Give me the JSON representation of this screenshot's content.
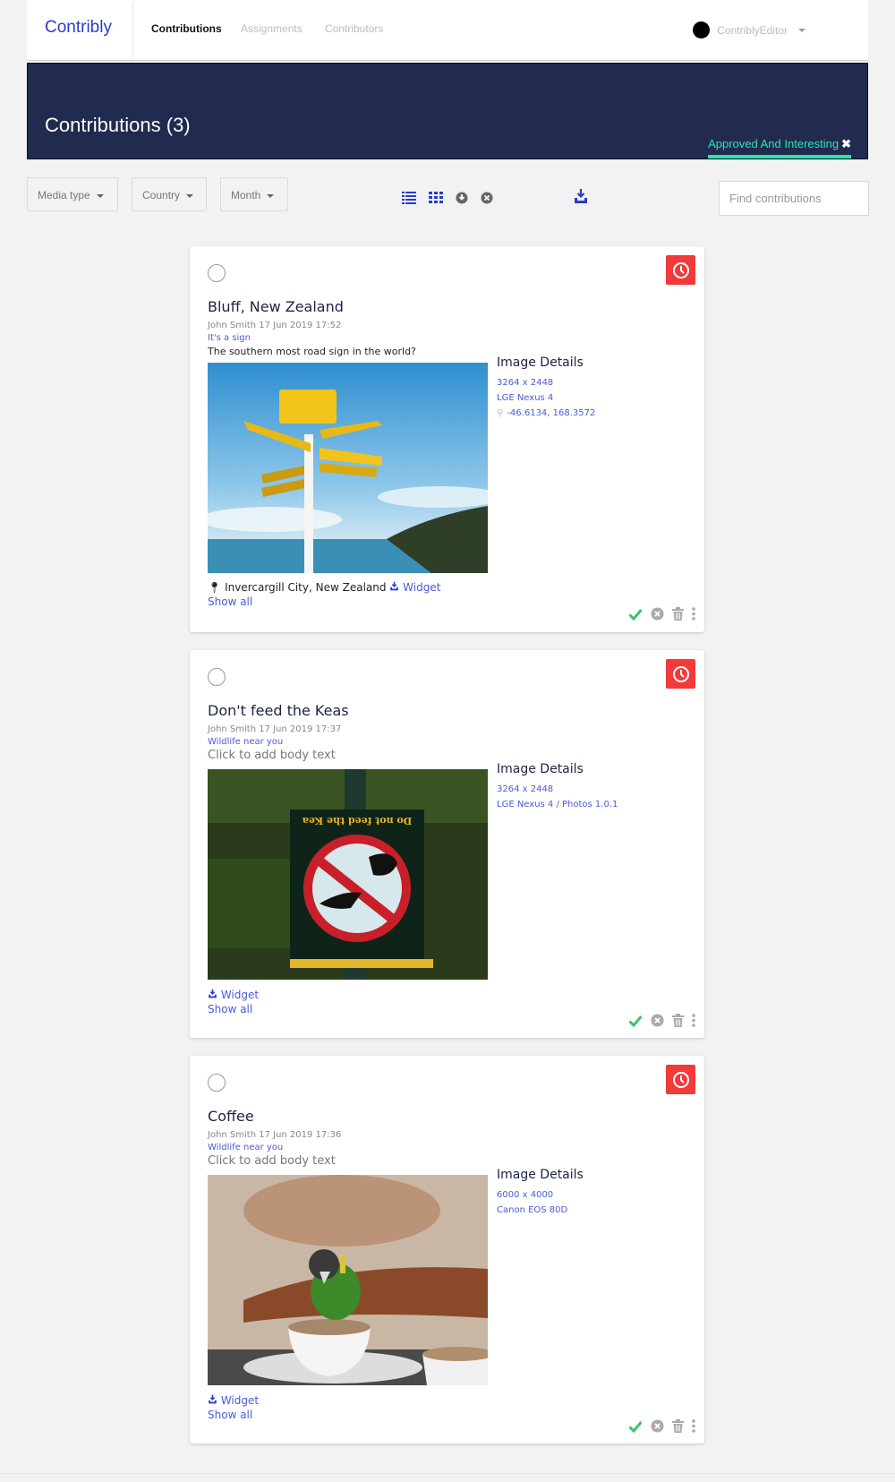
{
  "nav": {
    "brand": "Contribly",
    "items": [
      {
        "label": "Contributions",
        "active": true
      },
      {
        "label": "Assignments",
        "active": false
      },
      {
        "label": "Contributors",
        "active": false
      }
    ],
    "user": "ContriblyEditor"
  },
  "banner": {
    "title": "Contributions (3)",
    "filter_tag": "Approved And Interesting",
    "filter_close_icon": "close-icon"
  },
  "toolbar": {
    "dropdowns": [
      "Media type",
      "Country",
      "Month"
    ],
    "view_icons": [
      "list-view-icon",
      "grid-view-icon",
      "download-circle-icon",
      "clear-circle-icon",
      "export-download-icon"
    ],
    "search_placeholder": "Find contributions",
    "search_value": ""
  },
  "colors": {
    "brand": "#2a3bc6",
    "banner": "#212a4f",
    "accent_green": "#2de3b0",
    "link": "#4a5bd6",
    "clock_red": "#f23a3a",
    "approve_green": "#3ec26b",
    "icon_gray": "#aaaaaa"
  },
  "cards": [
    {
      "title": "Bluff, New Zealand",
      "meta": "John Smith 17 Jun 2019 17:52",
      "assignment": "It's a sign",
      "body": "The southern most road sign in the world?",
      "body_is_placeholder": false,
      "image_alt": "Yellow signpost at Bluff with destinations London, Hobart, Sydney, Wellington over the sea",
      "details_title": "Image Details",
      "details": [
        "3264 x 2448",
        "LGE Nexus 4"
      ],
      "coordinates": "-46.6134, 168.3572",
      "location": "Invercargill City, New Zealand",
      "widget_label": "Widget",
      "show_all": "Show all"
    },
    {
      "title": "Don't feed the Keas",
      "meta": "John Smith 17 Jun 2019 17:37",
      "assignment": "Wildlife near you",
      "body": "Click to add body text",
      "body_is_placeholder": true,
      "image_alt": "Sign reading Do not feed the Kea with prohibition symbol",
      "details_title": "Image Details",
      "details": [
        "3264 x 2448",
        "LGE Nexus 4 / Photos 1.0.1"
      ],
      "widget_label": "Widget",
      "show_all": "Show all"
    },
    {
      "title": "Coffee",
      "meta": "John Smith 17 Jun 2019 17:36",
      "assignment": "Wildlife near you",
      "body": "Click to add body text",
      "body_is_placeholder": true,
      "image_alt": "Green parrot drinking from a coffee cup on a cafe table",
      "details_title": "Image Details",
      "details": [
        "6000 x 4000",
        "Canon EOS 80D"
      ],
      "widget_label": "Widget",
      "show_all": "Show all"
    }
  ]
}
